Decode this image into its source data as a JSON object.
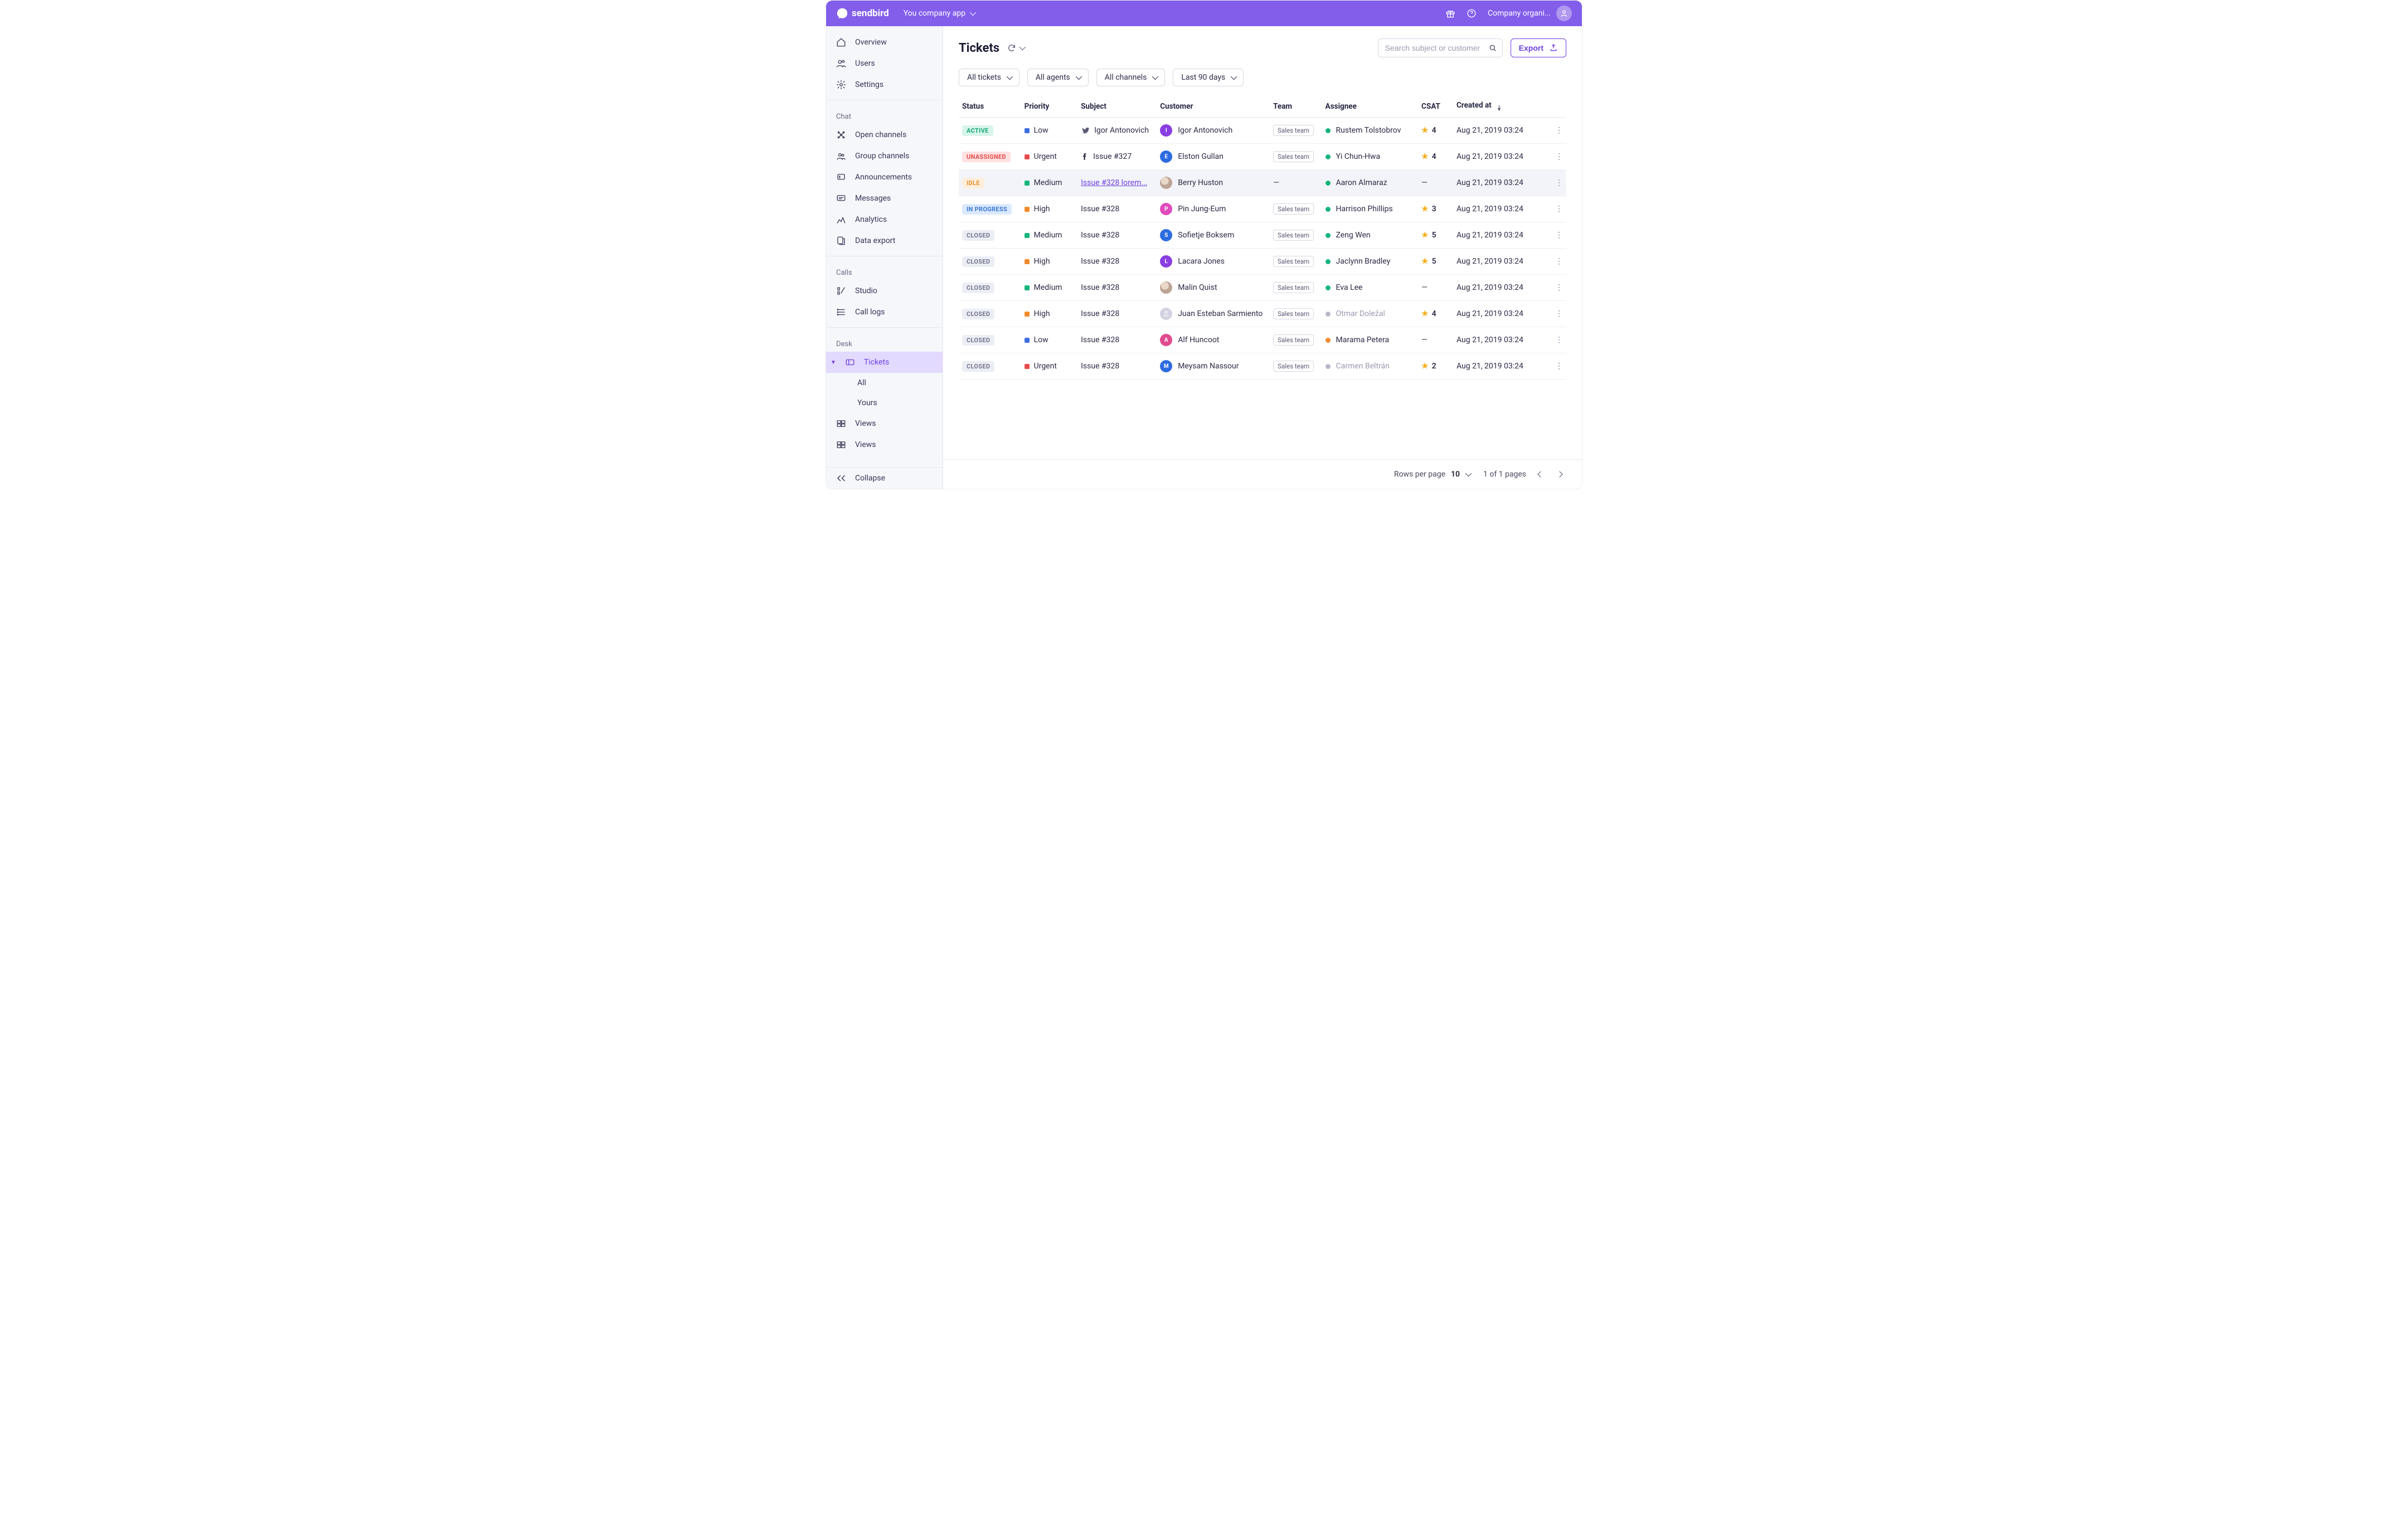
{
  "brand": "sendbird",
  "app_switcher": {
    "label": "You company app"
  },
  "org": {
    "label": "Company organi..."
  },
  "sidebar": {
    "top": [
      {
        "id": "overview",
        "label": "Overview"
      },
      {
        "id": "users",
        "label": "Users"
      },
      {
        "id": "settings",
        "label": "Settings"
      }
    ],
    "sections": [
      {
        "title": "Chat",
        "items": [
          {
            "id": "open-channels",
            "label": "Open channels"
          },
          {
            "id": "group-channels",
            "label": "Group channels"
          },
          {
            "id": "announcements",
            "label": "Announcements"
          },
          {
            "id": "messages",
            "label": "Messages"
          },
          {
            "id": "analytics",
            "label": "Analytics"
          },
          {
            "id": "data-export",
            "label": "Data export"
          }
        ]
      },
      {
        "title": "Calls",
        "items": [
          {
            "id": "studio",
            "label": "Studio"
          },
          {
            "id": "call-logs",
            "label": "Call logs"
          }
        ]
      },
      {
        "title": "Desk",
        "items": [
          {
            "id": "tickets",
            "label": "Tickets",
            "selected": true,
            "sub": [
              {
                "id": "all",
                "label": "All"
              },
              {
                "id": "yours",
                "label": "Yours"
              }
            ]
          },
          {
            "id": "views1",
            "label": "Views"
          },
          {
            "id": "views2",
            "label": "Views"
          }
        ]
      }
    ],
    "collapse": "Collapse"
  },
  "page": {
    "title": "Tickets",
    "search_placeholder": "Search subject or customer",
    "export": "Export"
  },
  "filters": [
    {
      "id": "tickets",
      "label": "All tickets"
    },
    {
      "id": "agents",
      "label": "All agents"
    },
    {
      "id": "channels",
      "label": "All channels"
    },
    {
      "id": "dates",
      "label": "Last 90 days"
    }
  ],
  "columns": {
    "status": "Status",
    "priority": "Priority",
    "subject": "Subject",
    "customer": "Customer",
    "team": "Team",
    "assignee": "Assignee",
    "csat": "CSAT",
    "created": "Created at"
  },
  "status_styles": {
    "ACTIVE": {
      "bg": "#d7f5ea",
      "fg": "#16a77a"
    },
    "UNASSIGNED": {
      "bg": "#ffe1e1",
      "fg": "#e64b4b"
    },
    "IDLE": {
      "bg": "#ffeeda",
      "fg": "#e0902e"
    },
    "IN PROGRESS": {
      "bg": "#dbe9ff",
      "fg": "#3a78d6"
    },
    "CLOSED": {
      "bg": "#eceef5",
      "fg": "#777790"
    }
  },
  "priority_colors": {
    "Low": "#3b6fe0",
    "Medium": "#16b57a",
    "High": "#f08a2c",
    "Urgent": "#e64b4b"
  },
  "assignee_status_colors": {
    "online": "#16b57a",
    "away": "#f08a2c",
    "offline": "#b7b7c7"
  },
  "rows": [
    {
      "status": "ACTIVE",
      "priority": "Low",
      "subject_icon": "twitter",
      "subject": "Igor Antonovich",
      "customer": {
        "name": "Igor Antonovich",
        "initial": "I",
        "color": "#8a3fe0"
      },
      "team": "Sales team",
      "assignee": {
        "name": "Rustem Tolstobrov",
        "status": "online"
      },
      "csat": "4",
      "created": "Aug 21, 2019 03:24"
    },
    {
      "status": "UNASSIGNED",
      "priority": "Urgent",
      "subject_icon": "facebook",
      "subject": "Issue #327",
      "customer": {
        "name": "Elston Gullan",
        "initial": "E",
        "color": "#2d6be0"
      },
      "team": "Sales team",
      "assignee": {
        "name": "Yi Chun-Hwa",
        "status": "online"
      },
      "csat": "4",
      "created": "Aug 21, 2019 03:24"
    },
    {
      "status": "IDLE",
      "priority": "Medium",
      "subject_icon": "",
      "subject": "Issue #328 lorem...",
      "subject_link": true,
      "customer": {
        "name": "Berry Huston",
        "initial": "",
        "color": "",
        "photo": true
      },
      "team": "—",
      "assignee": {
        "name": "Aaron Almaraz",
        "status": "online"
      },
      "csat": "—",
      "created": "Aug 21, 2019 03:24",
      "hovered": true
    },
    {
      "status": "IN PROGRESS",
      "priority": "High",
      "subject_icon": "",
      "subject": "Issue #328",
      "customer": {
        "name": "Pin Jung-Eum",
        "initial": "P",
        "color": "#e04bbd"
      },
      "team": "Sales team",
      "assignee": {
        "name": "Harrison Phillips",
        "status": "online"
      },
      "csat": "3",
      "created": "Aug 21, 2019 03:24"
    },
    {
      "status": "CLOSED",
      "priority": "Medium",
      "subject_icon": "",
      "subject": "Issue #328",
      "customer": {
        "name": "Sofietje Boksem",
        "initial": "S",
        "color": "#2d6be0"
      },
      "team": "Sales team",
      "assignee": {
        "name": "Zeng Wen",
        "status": "online"
      },
      "csat": "5",
      "created": "Aug 21, 2019 03:24"
    },
    {
      "status": "CLOSED",
      "priority": "High",
      "subject_icon": "",
      "subject": "Issue #328",
      "customer": {
        "name": "Lacara Jones",
        "initial": "L",
        "color": "#8a3fe0"
      },
      "team": "Sales team",
      "assignee": {
        "name": "Jaclynn Bradley",
        "status": "online"
      },
      "csat": "5",
      "created": "Aug 21, 2019 03:24"
    },
    {
      "status": "CLOSED",
      "priority": "Medium",
      "subject_icon": "",
      "subject": "Issue #328",
      "customer": {
        "name": "Malin Quist",
        "initial": "",
        "color": "",
        "photo": true
      },
      "team": "Sales team",
      "assignee": {
        "name": "Eva Lee",
        "status": "online"
      },
      "csat": "—",
      "created": "Aug 21, 2019 03:24"
    },
    {
      "status": "CLOSED",
      "priority": "High",
      "subject_icon": "",
      "subject": "Issue #328",
      "customer": {
        "name": "Juan Esteban Sarmiento",
        "initial": "",
        "color": "#d2d2e2",
        "placeholder": true
      },
      "team": "Sales team",
      "assignee": {
        "name": "Otmar Doležal",
        "status": "offline"
      },
      "csat": "4",
      "created": "Aug 21, 2019 03:24"
    },
    {
      "status": "CLOSED",
      "priority": "Low",
      "subject_icon": "",
      "subject": "Issue #328",
      "customer": {
        "name": "Alf Huncoot",
        "initial": "A",
        "color": "#e04b8f"
      },
      "team": "Sales team",
      "assignee": {
        "name": "Marama Petera",
        "status": "away"
      },
      "csat": "—",
      "created": "Aug 21, 2019 03:24"
    },
    {
      "status": "CLOSED",
      "priority": "Urgent",
      "subject_icon": "",
      "subject": "Issue #328",
      "customer": {
        "name": "Meysam Nassour",
        "initial": "M",
        "color": "#2d6be0"
      },
      "team": "Sales team",
      "assignee": {
        "name": "Carmen Beltrán",
        "status": "offline"
      },
      "csat": "2",
      "created": "Aug 21, 2019 03:24"
    }
  ],
  "footer": {
    "rows_per_page_label": "Rows per page",
    "rows_per_page": "10",
    "page_info": "1 of 1 pages"
  }
}
